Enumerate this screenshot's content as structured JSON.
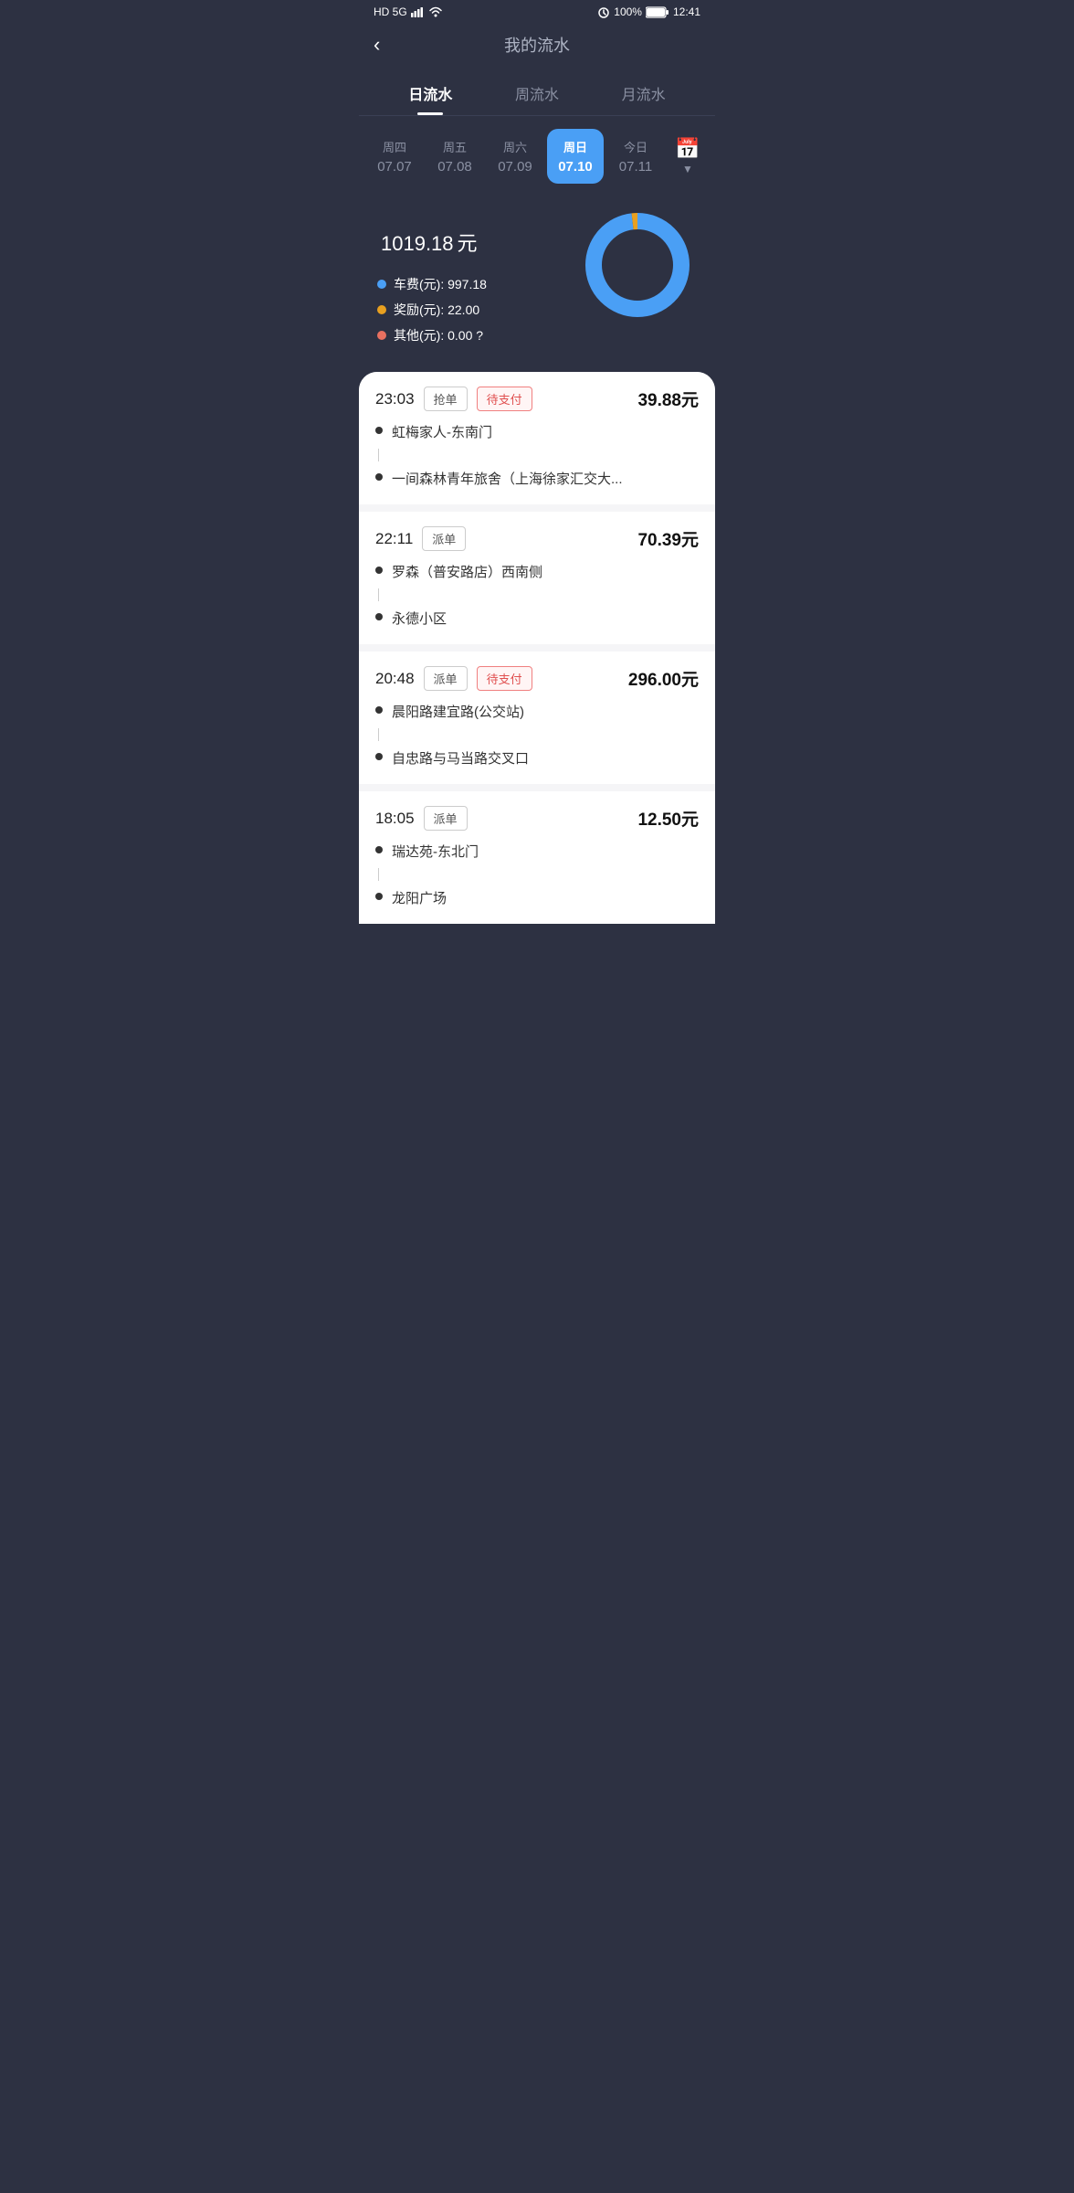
{
  "statusBar": {
    "left": "HD 5G",
    "battery": "100%",
    "time": "12:41"
  },
  "header": {
    "backLabel": "‹",
    "title": "我的流水"
  },
  "tabs": [
    {
      "id": "daily",
      "label": "日流水",
      "active": true
    },
    {
      "id": "weekly",
      "label": "周流水",
      "active": false
    },
    {
      "id": "monthly",
      "label": "月流水",
      "active": false
    }
  ],
  "days": [
    {
      "name": "周四",
      "date": "07.07",
      "active": false
    },
    {
      "name": "周五",
      "date": "07.08",
      "active": false
    },
    {
      "name": "周六",
      "date": "07.09",
      "active": false
    },
    {
      "name": "周日",
      "date": "07.10",
      "active": true
    },
    {
      "name": "今日",
      "date": "07.11",
      "active": false
    }
  ],
  "summary": {
    "amount": "1019.18",
    "unit": "元",
    "items": [
      {
        "color": "dot-blue",
        "label": "车费(元): 997.18"
      },
      {
        "color": "dot-gold",
        "label": "奖励(元): 22.00"
      },
      {
        "color": "dot-red",
        "label": "其他(元): 0.00 ?"
      }
    ],
    "chart": {
      "bluePercent": 97.8,
      "goldPercent": 2.2
    }
  },
  "transactions": [
    {
      "time": "23:03",
      "tag": "抢单",
      "tagStyle": "normal",
      "statusTag": "待支付",
      "statusStyle": "pending",
      "amount": "39.88元",
      "stops": [
        "虹梅家人-东南门",
        "一间森林青年旅舍（上海徐家汇交大..."
      ]
    },
    {
      "time": "22:11",
      "tag": "派单",
      "tagStyle": "normal",
      "statusTag": "",
      "statusStyle": "",
      "amount": "70.39元",
      "stops": [
        "罗森（普安路店）西南侧",
        "永德小区"
      ]
    },
    {
      "time": "20:48",
      "tag": "派单",
      "tagStyle": "normal",
      "statusTag": "待支付",
      "statusStyle": "pending",
      "amount": "296.00元",
      "stops": [
        "晨阳路建宜路(公交站)",
        "自忠路与马当路交叉口"
      ]
    },
    {
      "time": "18:05",
      "tag": "派单",
      "tagStyle": "normal",
      "statusTag": "",
      "statusStyle": "",
      "amount": "12.50元",
      "stops": [
        "瑞达苑-东北门",
        "龙阳广场"
      ]
    }
  ]
}
